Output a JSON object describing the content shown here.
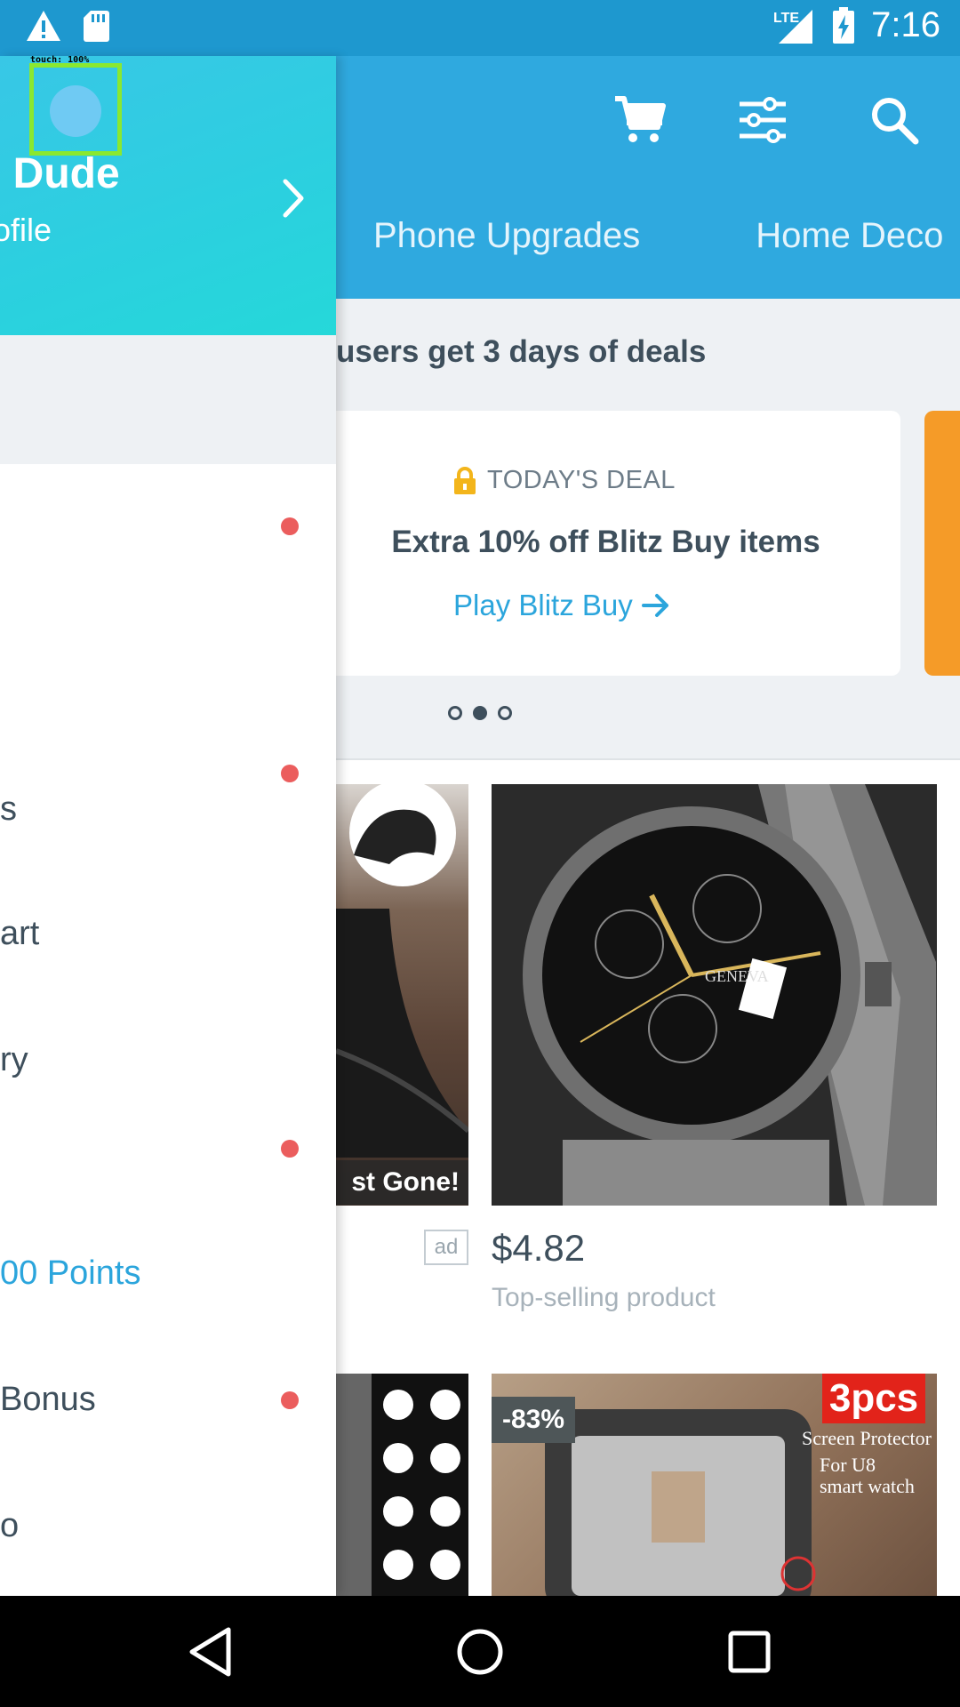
{
  "status_bar": {
    "time": "7:16",
    "network": "LTE",
    "icons": [
      "warning-icon",
      "sd-card-icon",
      "signal-icon",
      "battery-charging-icon"
    ]
  },
  "header": {
    "icons": [
      "cart-icon",
      "filter-icon",
      "search-icon"
    ],
    "tabs": [
      "Phone Upgrades",
      "Home Deco"
    ]
  },
  "promo": {
    "heading": "users get 3 days of deals",
    "deal_label": "TODAY'S DEAL",
    "deal_title": "Extra 10% off Blitz Buy items",
    "deal_link": "Play Blitz Buy",
    "carousel_active_index": 1,
    "carousel_count": 3
  },
  "products": [
    {
      "badge": "st Gone!",
      "ad_label": "ad"
    },
    {
      "price": "$4.82",
      "subtitle": "Top-selling product"
    },
    {
      "badge": "-83%",
      "pcs": "3pcs",
      "caption1": "Screen Protector",
      "caption2": "For U8",
      "caption3": "smart watch"
    }
  ],
  "drawer": {
    "user_name": "o Dude",
    "profile_link": "rofile",
    "touch_label": "touch: 100%",
    "menu": [
      {
        "label": "",
        "dot": true
      },
      {
        "label": "s",
        "dot": true
      },
      {
        "label": "art",
        "dot": false
      },
      {
        "label": "ry",
        "dot": false
      },
      {
        "label": "",
        "dot": true
      },
      {
        "label": "00 Points",
        "dot": false,
        "highlight": true
      },
      {
        "label": "Bonus",
        "dot": true
      },
      {
        "label": "o",
        "dot": false
      }
    ]
  },
  "nav_bar": {
    "buttons": [
      "back-icon",
      "home-icon",
      "recents-icon"
    ]
  },
  "colors": {
    "header_blue": "#2fa9df",
    "drawer_cyan": "#2bd0df",
    "link_blue": "#2ba5dc",
    "text_dark": "#3e4f5c",
    "notification_red": "#eb5d5d",
    "deal_orange": "#f59b28"
  }
}
